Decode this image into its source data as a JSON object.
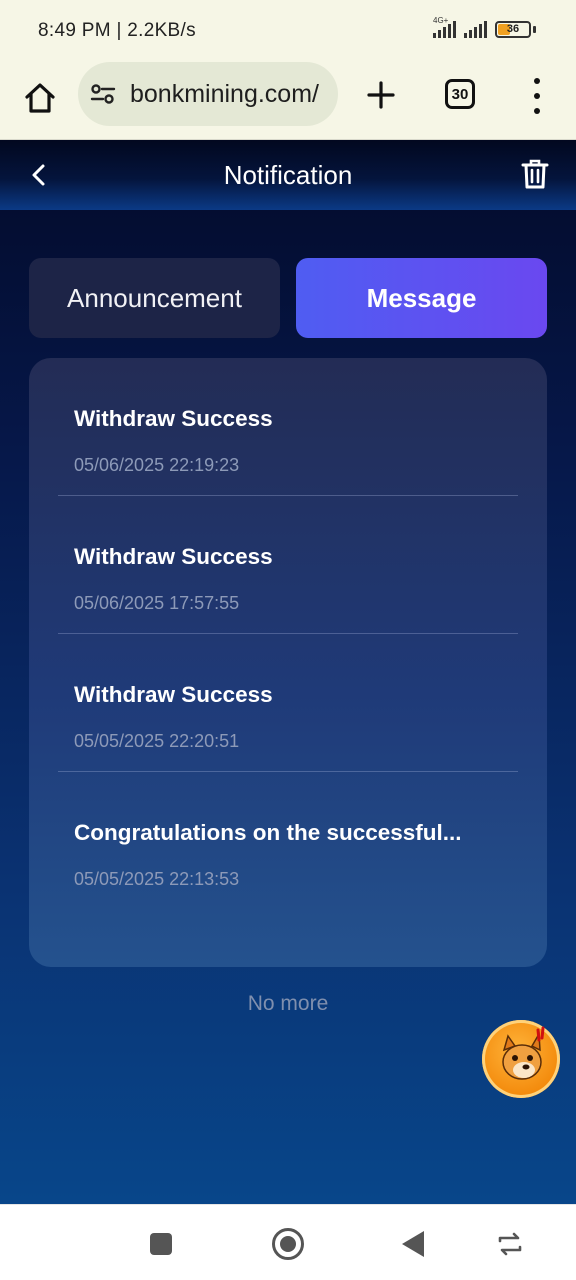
{
  "status_bar": {
    "time": "8:49 PM",
    "speed": "2.2KB/s",
    "network": "4G+",
    "battery": "36"
  },
  "browser": {
    "url": "bonkmining.com/",
    "tab_count": "30"
  },
  "header": {
    "title": "Notification"
  },
  "tabs": [
    {
      "label": "Announcement",
      "active": false
    },
    {
      "label": "Message",
      "active": true
    }
  ],
  "messages": [
    {
      "title": "Withdraw Success",
      "date": "05/06/2025 22:19:23"
    },
    {
      "title": "Withdraw Success",
      "date": "05/06/2025 17:57:55"
    },
    {
      "title": "Withdraw Success",
      "date": "05/05/2025 22:20:51"
    },
    {
      "title": "Congratulations on the successful...",
      "date": "05/05/2025 22:13:53"
    }
  ],
  "list_footer": "No more",
  "colors": {
    "active_tab_start": "#4f5df2",
    "active_tab_end": "#6a48f0",
    "inactive_tab": "#1d2447",
    "app_bg_top": "#030a2a",
    "app_bg_bottom": "#08468a",
    "date_text": "#8d9ab8"
  }
}
